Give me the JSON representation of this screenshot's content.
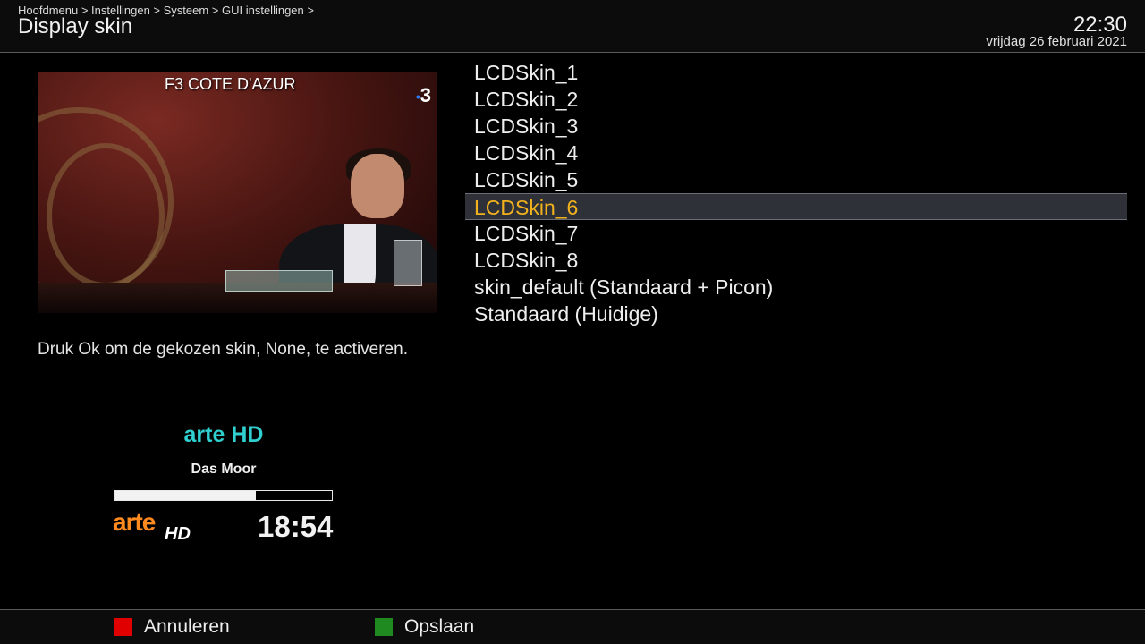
{
  "header": {
    "breadcrumb": "Hoofdmenu > Instellingen > Systeem > GUI instellingen >",
    "title": "Display skin",
    "time": "22:30",
    "date": "vrijdag 26 februari 2021"
  },
  "preview": {
    "channel_overlay": "F3 COTE D'AZUR",
    "channel_logo": "3",
    "logo_dot": "•"
  },
  "description": "Druk Ok om de gekozen skin, None, te activeren.",
  "lcd_preview": {
    "channel_name": "arte HD",
    "program": "Das Moor",
    "progress": 0.65,
    "logo_text": "arte",
    "logo_suffix": "HD",
    "time": "18:54"
  },
  "skins": [
    {
      "label": "LCDSkin_1",
      "selected": false
    },
    {
      "label": "LCDSkin_2",
      "selected": false
    },
    {
      "label": "LCDSkin_3",
      "selected": false
    },
    {
      "label": "LCDSkin_4",
      "selected": false
    },
    {
      "label": "LCDSkin_5",
      "selected": false
    },
    {
      "label": "LCDSkin_6",
      "selected": true
    },
    {
      "label": "LCDSkin_7",
      "selected": false
    },
    {
      "label": "LCDSkin_8",
      "selected": false
    },
    {
      "label": "skin_default (Standaard + Picon)",
      "selected": false
    },
    {
      "label": "Standaard (Huidige)",
      "selected": false
    }
  ],
  "footer": {
    "cancel_label": "Annuleren",
    "cancel_color": "#e00000",
    "save_label": "Opslaan",
    "save_color": "#1f8a1f"
  }
}
